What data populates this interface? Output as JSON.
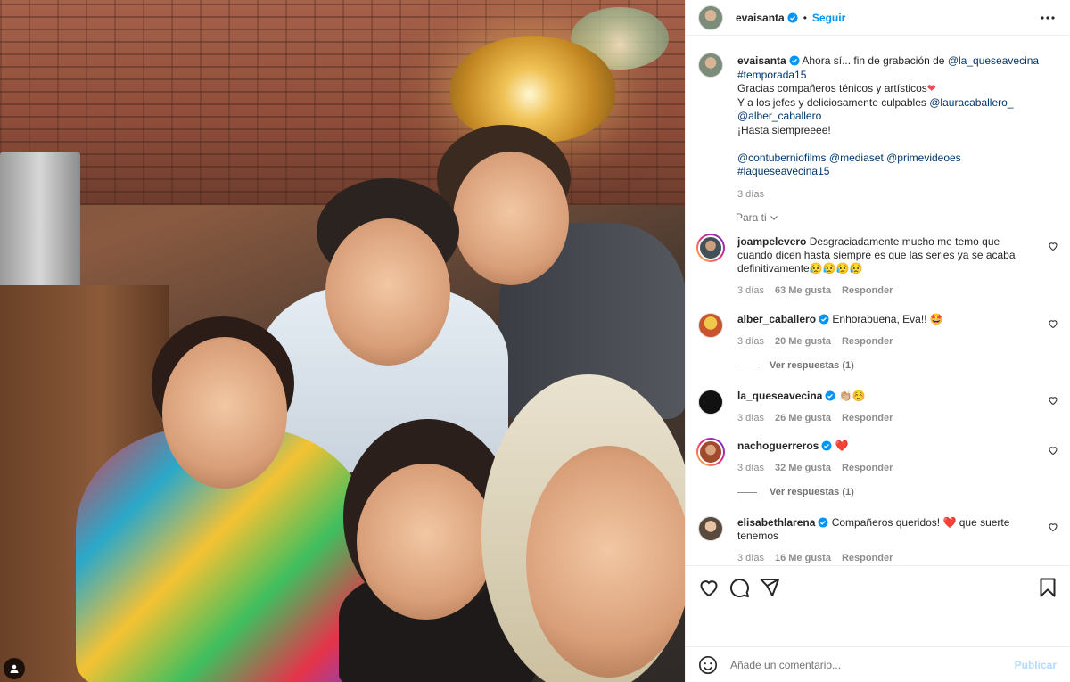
{
  "post": {
    "username": "evaisanta",
    "follow_label": "Seguir",
    "dot": "•"
  },
  "caption": {
    "username": "evaisanta",
    "line1_text": "Ahora sí... fin de grabación de",
    "line1_mention": "@la_queseavecina",
    "hashtag1": "#temporada15",
    "line2": "Gracias compañeros ténicos y artísticos",
    "line3_text": "Y a los jefes y deliciosamente culpables",
    "mention_laura": "@lauracaballero_",
    "mention_alber": "@alber_caballero",
    "line4": "¡Hasta siempreeee!",
    "mention_contu": "@contuberniofilms",
    "mention_mediaset": "@mediaset",
    "mention_prime": "@primevideoes",
    "hashtag2": "#laqueseavecina15",
    "time": "3 días"
  },
  "for_you_label": "Para ti",
  "comments": [
    {
      "username": "joampelevero",
      "text": "Desgraciadamente mucho me temo que cuando dicen hasta siempre es que las series ya se acaba definitivamente😥😥😥😥",
      "time": "3 días",
      "likes": "63 Me gusta",
      "reply": "Responder"
    },
    {
      "username": "alber_caballero",
      "text": "Enhorabuena, Eva!! 🤩",
      "time": "3 días",
      "likes": "20 Me gusta",
      "reply": "Responder",
      "view_replies": "Ver respuestas (1)"
    },
    {
      "username": "la_queseavecina",
      "text": "👏🏼☺️",
      "time": "3 días",
      "likes": "26 Me gusta",
      "reply": "Responder"
    },
    {
      "username": "nachoguerreros",
      "text": "❤️",
      "time": "3 días",
      "likes": "32 Me gusta",
      "reply": "Responder",
      "view_replies": "Ver respuestas (1)"
    },
    {
      "username": "elisabethlarena",
      "text": "Compañeros queridos! ❤️ que suerte tenemos",
      "time": "3 días",
      "likes": "16 Me gusta",
      "reply": "Responder"
    }
  ],
  "add_comment": {
    "placeholder": "Añade un comentario...",
    "publish": "Publicar"
  },
  "colors": {
    "accent": "#0095f6",
    "link": "#00376b",
    "muted": "#8e8e8e",
    "heart": "#ed4956"
  },
  "icons": [
    "more-icon",
    "verified-icon",
    "chevron-down-icon",
    "heart-icon",
    "comment-icon",
    "share-icon",
    "bookmark-icon",
    "emoji-icon",
    "user-tag-icon"
  ]
}
